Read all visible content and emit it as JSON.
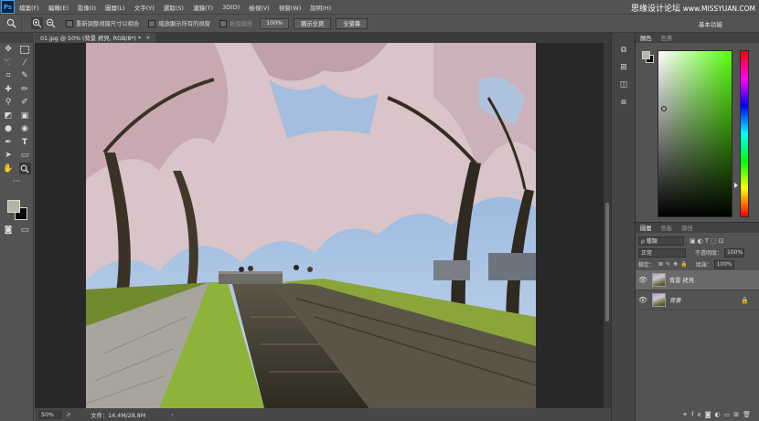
{
  "app": {
    "logo": "Ps"
  },
  "menu": [
    "檔案(F)",
    "編輯(E)",
    "影像(I)",
    "圖層(L)",
    "文字(Y)",
    "選取(S)",
    "濾鏡(T)",
    "3D(D)",
    "檢視(V)",
    "視窗(W)",
    "說明(H)"
  ],
  "watermark": {
    "brand": "思缘设计论坛",
    "site": "www.MISSYUAN.COM"
  },
  "options": {
    "resize_windows": "重新調整視窗尺寸以相合",
    "zoom_all": "縮放顯示所有的視窗",
    "scrubby_zoom": "拖曳縮放",
    "zoom_value": "100%",
    "fit_screen": "顯示全頁",
    "fill_screen": "全螢幕",
    "workspace": "基本功能"
  },
  "document": {
    "tab_title": "01.jpg @ 50% (背景 拷貝, RGB/8*) *",
    "close": "×"
  },
  "status": {
    "zoom": "50%",
    "doc_size": "文件：14.4M/28.8M",
    "arrow": "›"
  },
  "color_panel": {
    "tabs": [
      "顏色",
      "色票"
    ],
    "foreground": "#b5b4a8",
    "background": "#0a0a0a",
    "hue_color": "#58ff0c"
  },
  "layers_panel": {
    "tabs": [
      "圖層",
      "色板",
      "路徑"
    ],
    "filter_kind": "ρ 種類",
    "blend_mode": "正常",
    "opacity_label": "不透明度：",
    "opacity_value": "100%",
    "lock_label": "鎖定：",
    "fill_label": "填滿：",
    "fill_value": "100%",
    "layers": [
      {
        "name": "背景 拷貝",
        "selected": true
      },
      {
        "name": "背景",
        "selected": false,
        "locked": true
      }
    ]
  },
  "icons": {
    "tools": [
      "move-icon",
      "marquee-icon",
      "lasso-icon",
      "magic-wand-icon",
      "crop-icon",
      "eyedropper-icon",
      "healing-icon",
      "brush-icon",
      "stamp-icon",
      "history-brush-icon",
      "eraser-icon",
      "gradient-icon",
      "blur-icon",
      "dodge-icon",
      "pen-icon",
      "type-icon",
      "path-select-icon",
      "rectangle-icon",
      "hand-icon",
      "zoom-icon"
    ]
  }
}
